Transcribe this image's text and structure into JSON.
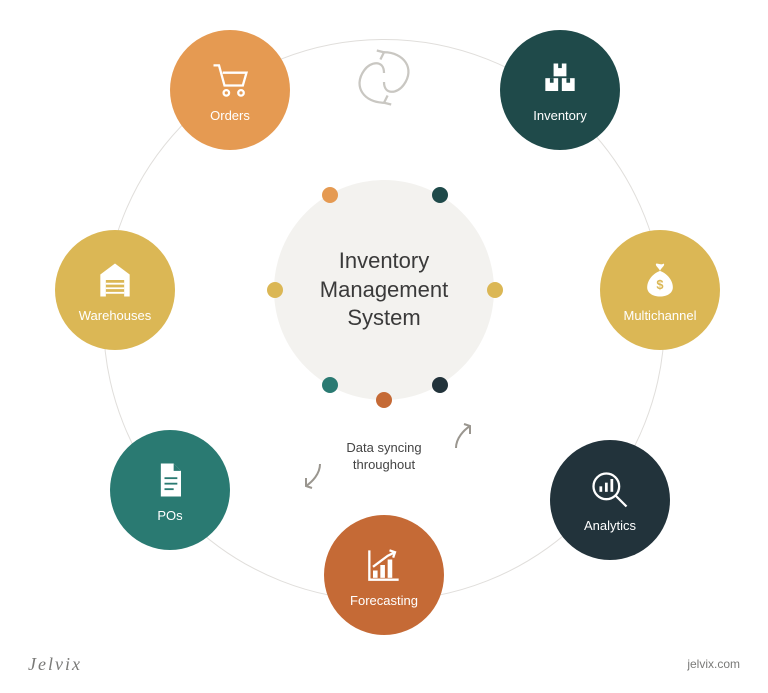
{
  "center_title": "Inventory\nManagement\nSystem",
  "sync_caption": "Data syncing\nthroughout",
  "footer": {
    "brand": "Jelvix",
    "url": "jelvix.com"
  },
  "nodes": {
    "orders": {
      "label": "Orders",
      "color": "#e59a52"
    },
    "inventory": {
      "label": "Inventory",
      "color": "#1f4a4a"
    },
    "multichannel": {
      "label": "Multichannel",
      "color": "#dbb755"
    },
    "analytics": {
      "label": "Analytics",
      "color": "#22333b"
    },
    "forecasting": {
      "label": "Forecasting",
      "color": "#c56a36"
    },
    "pos": {
      "label": "POs",
      "color": "#2a7a72"
    },
    "warehouses": {
      "label": "Warehouses",
      "color": "#dbb755"
    }
  },
  "dots": [
    {
      "color": "#e59a52"
    },
    {
      "color": "#1f4a4a"
    },
    {
      "color": "#dbb755"
    },
    {
      "color": "#22333b"
    },
    {
      "color": "#c56a36"
    },
    {
      "color": "#2a7a72"
    }
  ]
}
